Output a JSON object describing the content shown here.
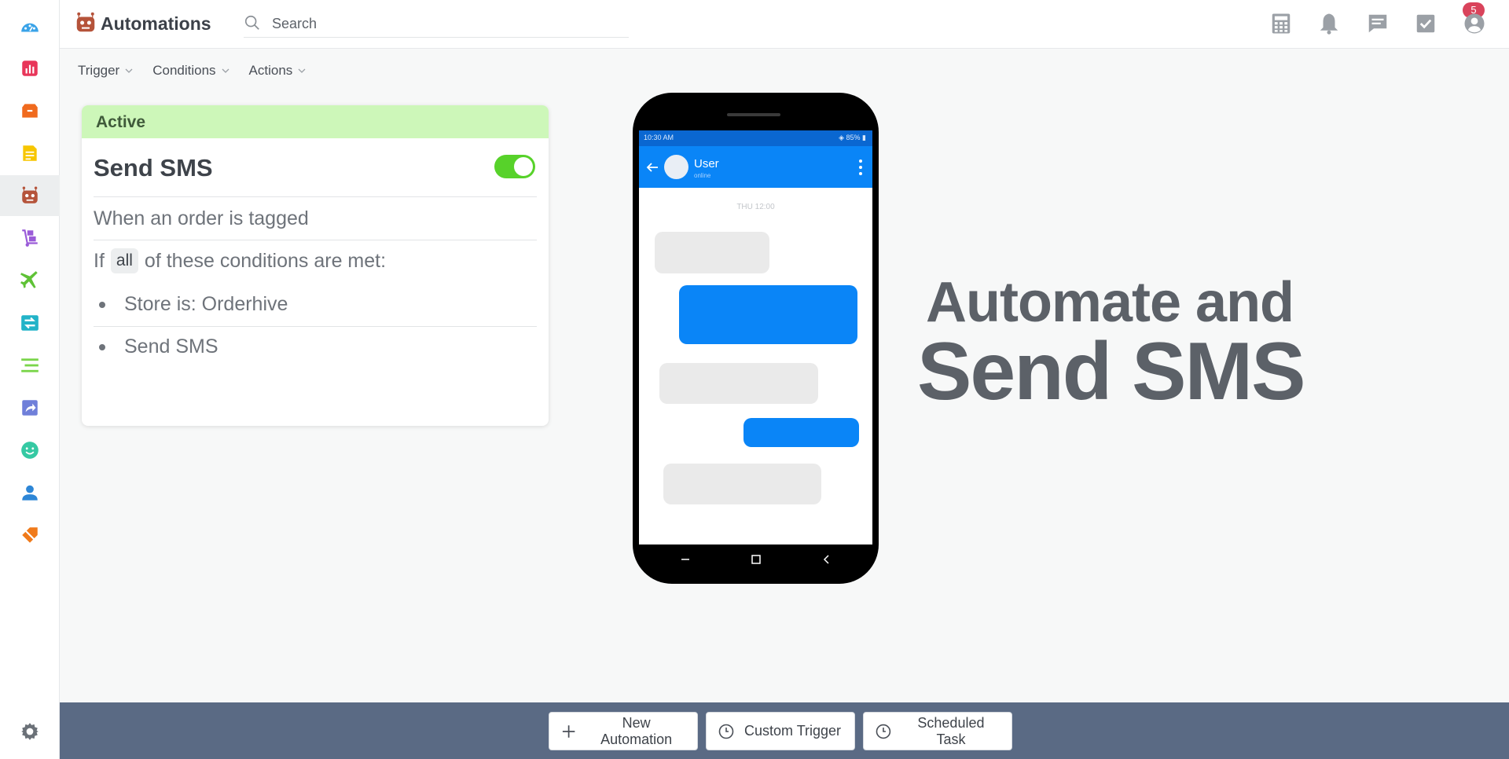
{
  "header": {
    "title": "Automations",
    "search_placeholder": "Search",
    "notification_count": "5"
  },
  "filters": [
    {
      "label": "Trigger"
    },
    {
      "label": "Conditions"
    },
    {
      "label": "Actions"
    }
  ],
  "card": {
    "status": "Active",
    "title": "Send SMS",
    "enabled": true,
    "trigger": "When an order is tagged",
    "conditions_prefix": "If",
    "conditions_match": "all",
    "conditions_suffix": "of these conditions are met:",
    "conditions": [
      "Store is: Orderhive"
    ],
    "actions": [
      "Send SMS"
    ]
  },
  "phone": {
    "status_time": "10:30 AM",
    "status_battery": "85%",
    "contact_name": "User",
    "contact_status": "online",
    "day_label": "THU 12:00"
  },
  "hero": {
    "line1": "Automate and",
    "line2": "Send SMS"
  },
  "footer": {
    "new_automation": "New Automation",
    "custom_trigger": "Custom Trigger",
    "scheduled_task": "Scheduled Task"
  },
  "colors": {
    "active_banner": "#cdf7b9",
    "toggle_on": "#57d22a",
    "bottom_bar": "#5a6a84",
    "badge": "#d9435b",
    "chat_out": "#0a85f7"
  }
}
